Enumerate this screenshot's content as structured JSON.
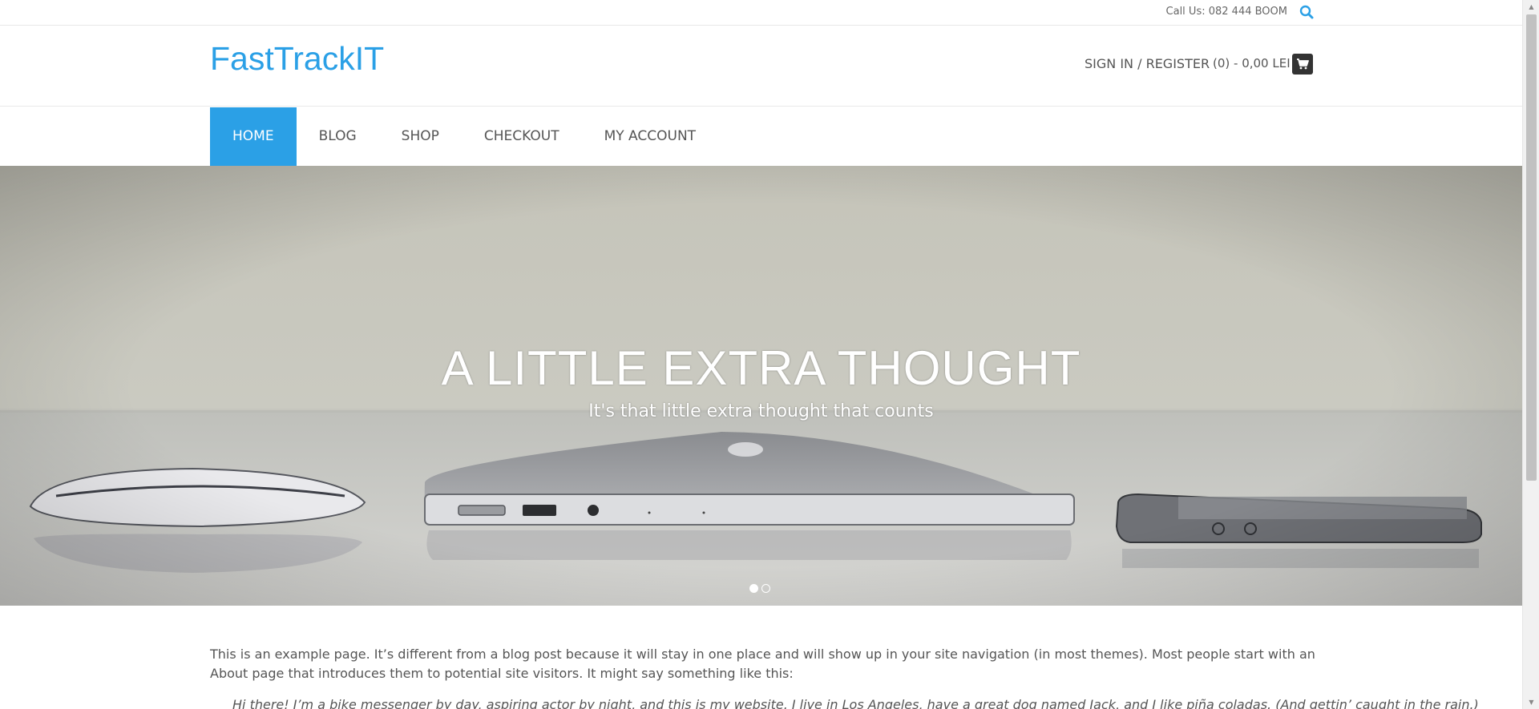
{
  "topbar": {
    "call_us": "Call Us: 082 444 BOOM",
    "search_icon": "search-icon"
  },
  "header": {
    "logo": "FastTrackIT",
    "signin": "SIGN IN / REGISTER",
    "cart_total": "(0) - 0,00 LEI",
    "cart_icon": "cart-icon"
  },
  "nav": {
    "items": [
      {
        "label": "HOME",
        "active": true
      },
      {
        "label": "BLOG"
      },
      {
        "label": "SHOP"
      },
      {
        "label": "CHECKOUT"
      },
      {
        "label": "MY ACCOUNT"
      }
    ]
  },
  "hero": {
    "title": "A LITTLE EXTRA THOUGHT",
    "subtitle": "It's that little extra thought that counts",
    "slides": 2,
    "active_slide": 1
  },
  "content": {
    "paragraph": "This is an example page. It’s different from a blog post because it will stay in one place and will show up in your site navigation (in most themes). Most people start with an About page that introduces them to potential site visitors. It might say something like this:",
    "quote": "Hi there! I’m a bike messenger by day, aspiring actor by night, and this is my website. I live in Los Angeles, have a great dog named Jack, and I like piña coladas. (And gettin’ caught in the rain.)"
  },
  "colors": {
    "accent": "#2ba0e6",
    "hero_text": "#ffffff",
    "cart_button": "#333333"
  }
}
